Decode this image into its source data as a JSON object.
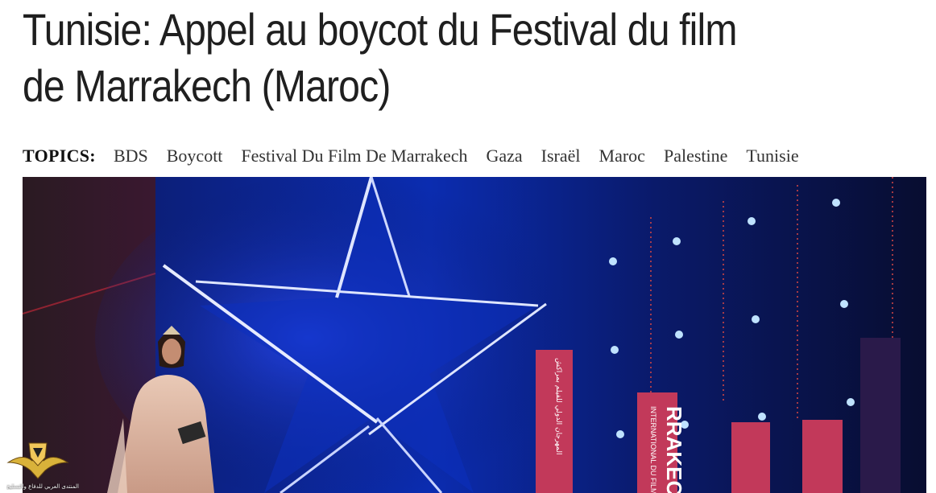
{
  "article": {
    "title": "Tunisie: Appel au boycot du Festival du film de Marrakech (Maroc)"
  },
  "topics": {
    "label": "TOPICS:",
    "items": [
      "BDS",
      "Boycott",
      "Festival Du Film De Marrakech",
      "Gaza",
      "Israël",
      "Maroc",
      "Palestine",
      "Tunisie"
    ]
  },
  "hero_image": {
    "banner_tall": "RRAKECH",
    "banner_tall_small": "INTERNATIONAL DU FILM DE",
    "banner_arabic": "المهرجان الدولي للفيلم بمراكش"
  },
  "watermark": {
    "text": "المنتدى العربي للدفاع والتسليح"
  },
  "colors": {
    "headline": "#1f1f1f",
    "stage_blue": "#0a1a8a",
    "banner_pink": "#c2395a"
  }
}
